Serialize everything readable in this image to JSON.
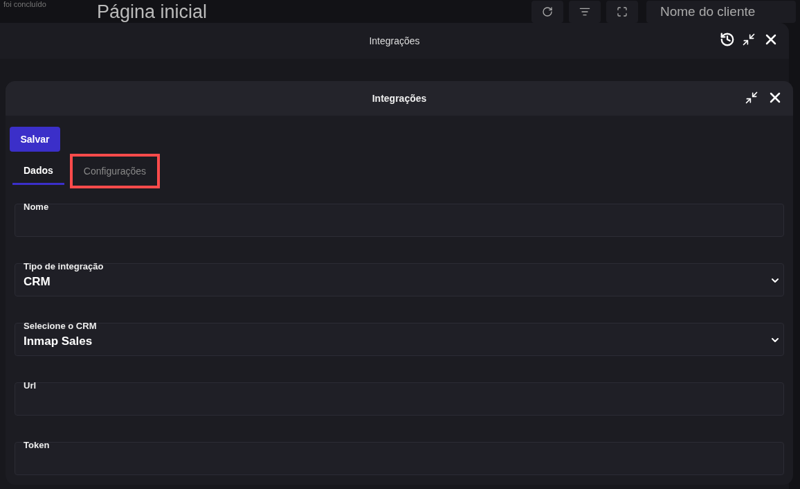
{
  "background": {
    "status_text": "foi concluído",
    "page_title": "Página inicial",
    "client_field": {
      "placeholder": "Nome do cliente"
    },
    "back_dialog": {
      "title": "Integrações"
    }
  },
  "dialog": {
    "title": "Integrações",
    "save_button": "Salvar",
    "tabs": [
      {
        "label": "Dados",
        "selected": true,
        "highlighted": false
      },
      {
        "label": "Configurações",
        "selected": false,
        "highlighted": true
      }
    ],
    "fields": [
      {
        "label": "Nome",
        "kind": "text"
      },
      {
        "label": "Tipo de integração",
        "kind": "select",
        "value": "CRM"
      },
      {
        "label": "Selecione o CRM",
        "kind": "select",
        "value": "Inmap Sales"
      },
      {
        "label": "Url",
        "kind": "text"
      },
      {
        "label": "Token",
        "kind": "text"
      }
    ]
  }
}
